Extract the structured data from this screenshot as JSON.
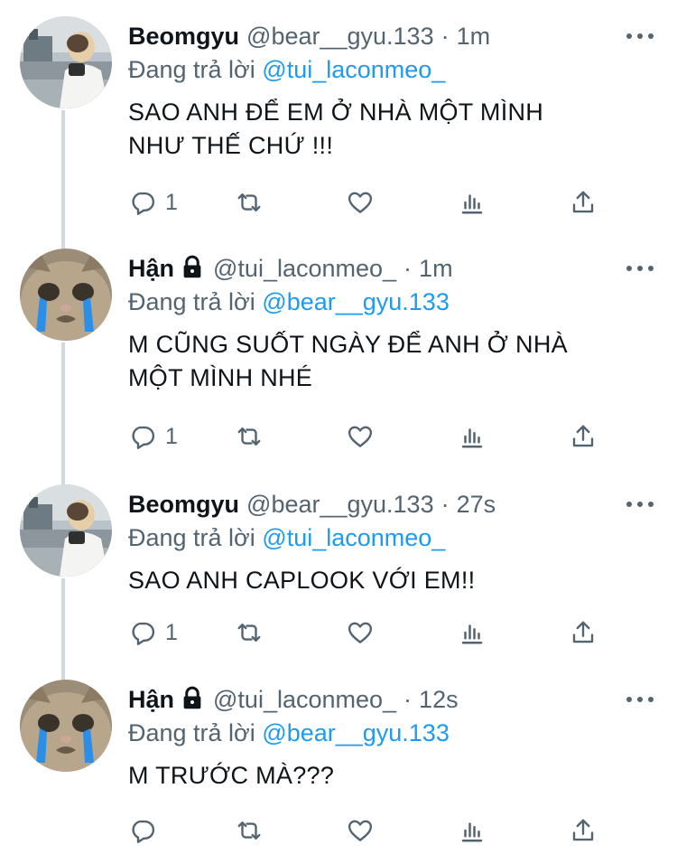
{
  "reply_prefix": "Đang trả lời",
  "colors": {
    "accent": "#1d9bf0",
    "secondary_text": "#536471",
    "thread_line": "#cfd9de"
  },
  "icons": {
    "reply": "reply-icon",
    "retweet": "retweet-icon",
    "like": "heart-icon",
    "stats": "analytics-icon",
    "share": "share-icon",
    "more": "more-icon",
    "lock": "lock-icon"
  },
  "tweets": [
    {
      "name": "Beomgyu",
      "handle": "@bear__gyu.133",
      "separator": "·",
      "time": "1m",
      "reply_to": "@tui_laconmeo_",
      "text_lines": [
        "SAO ANH ĐỂ EM Ở NHÀ MỘT MÌNH",
        "NHƯ THẾ CHỨ !!!"
      ],
      "reply_count": "1",
      "locked": false
    },
    {
      "name": "Hận",
      "handle": "@tui_laconmeo_",
      "separator": "·",
      "time": "1m",
      "reply_to": "@bear__gyu.133",
      "text_lines": [
        "M CŨNG SUỐT NGÀY ĐỂ ANH Ở NHÀ",
        "MỘT MÌNH NHÉ"
      ],
      "reply_count": "1",
      "locked": true
    },
    {
      "name": "Beomgyu",
      "handle": "@bear__gyu.133",
      "separator": "·",
      "time": "27s",
      "reply_to": "@tui_laconmeo_",
      "text_lines": [
        "SAO ANH CAPLOOK VỚI EM!!"
      ],
      "reply_count": "1",
      "locked": false
    },
    {
      "name": "Hận",
      "handle": "@tui_laconmeo_",
      "separator": "·",
      "time": "12s",
      "reply_to": "@bear__gyu.133",
      "text_lines": [
        "M TRƯỚC MÀ???"
      ],
      "reply_count": "",
      "locked": true
    }
  ]
}
